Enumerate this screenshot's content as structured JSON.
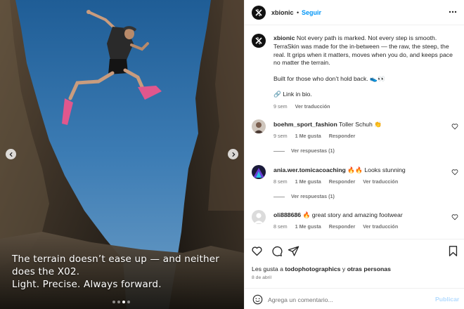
{
  "post": {
    "image_text": {
      "line1": "The terrain doesn’t ease up — and neither",
      "line2": "does the X02.",
      "line3": "Light. Precise. Always forward."
    },
    "carousel": {
      "slide_count": 4,
      "active_index": 2
    }
  },
  "header": {
    "username": "xbionic",
    "separator": "•",
    "follow_label": "Seguir"
  },
  "caption": {
    "username": "xbionic",
    "text": "Not every path is marked. Not every step is smooth. TerraSkin was made for the in-between — the raw, the steep, the real. It grips when it matters, moves when you do, and keeps pace no matter the terrain.",
    "paragraph2": "Built for those who don’t hold back. 👟👀",
    "paragraph3": "🔗 Link in bio.",
    "time": "9 sem",
    "translate_label": "Ver traducción"
  },
  "comments": [
    {
      "username": "boehm_sport_fashion",
      "text": "Toller Schuh 👏",
      "time": "9 sem",
      "likes": "1 Me gusta",
      "reply_label": "Responder",
      "translate_label": "",
      "view_replies": "Ver respuestas (1)"
    },
    {
      "username": "ania.wer.tomicacoaching",
      "text": "🔥🔥 Looks stunning",
      "time": "8 sem",
      "likes": "1 Me gusta",
      "reply_label": "Responder",
      "translate_label": "Ver traducción",
      "view_replies": "Ver respuestas (1)"
    },
    {
      "username": "oli888686",
      "text": "🔥 great story and amazing footwear",
      "time": "8 sem",
      "likes": "1 Me gusta",
      "reply_label": "Responder",
      "translate_label": "Ver traducción",
      "view_replies": ""
    }
  ],
  "footer": {
    "likes_prefix": "Les gusta a",
    "likes_user": "todophotographics",
    "likes_conj": "y",
    "likes_others": "otras personas",
    "date": "8 de abril",
    "comment_placeholder": "Agrega un comentario...",
    "publish_label": "Publicar"
  },
  "icons": {
    "more": "more-horizontal-icon",
    "like": "heart-icon",
    "comment": "comment-icon",
    "share": "send-icon",
    "save": "bookmark-icon",
    "emoji": "emoji-icon",
    "prev": "chevron-left-icon",
    "next": "chevron-right-icon"
  },
  "colors": {
    "link_blue": "#0095f6",
    "publish_disabled": "#b3dbff",
    "muted": "#737373",
    "text": "#262626"
  }
}
